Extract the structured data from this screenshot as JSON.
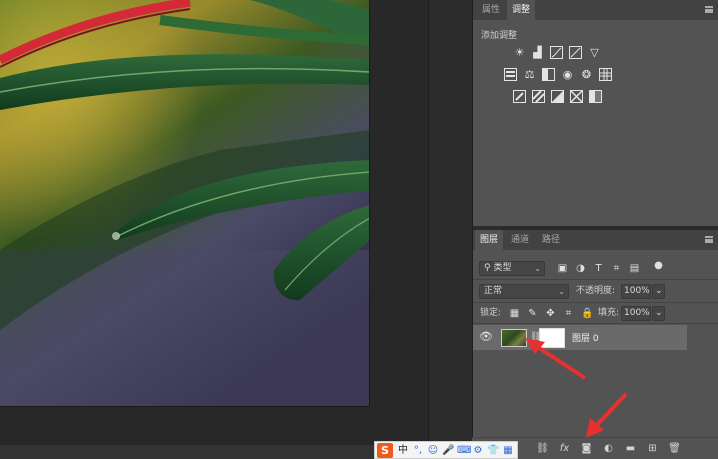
{
  "properties_panel": {
    "tab_properties": "属性",
    "tab_adjustments": "调整",
    "add_adjustment_title": "添加调整",
    "adjustment_icons_row1": [
      "brightness-contrast-icon",
      "levels-icon",
      "curves-icon",
      "exposure-icon",
      "vibrance-icon"
    ],
    "adjustment_icons_row2": [
      "hue-saturation-icon",
      "color-balance-icon",
      "black-white-icon",
      "photo-filter-icon",
      "channel-mixer-icon",
      "color-lookup-icon"
    ],
    "adjustment_icons_row3": [
      "invert-icon",
      "posterize-icon",
      "threshold-icon",
      "selective-color-icon",
      "gradient-map-icon"
    ]
  },
  "layers_panel": {
    "tab_layers": "图层",
    "tab_channels": "通道",
    "tab_paths": "路径",
    "filter_kind": "类型",
    "blend_mode": "正常",
    "opacity_label": "不透明度:",
    "opacity_value": "100%",
    "lock_label": "锁定:",
    "fill_label": "填充:",
    "fill_value": "100%",
    "layers": [
      {
        "name": "图层 0",
        "visible": true,
        "has_mask": true
      }
    ],
    "bottom_icons": [
      "link-layers-icon",
      "fx-icon",
      "add-mask-icon",
      "adjustment-layer-icon",
      "new-group-icon",
      "new-layer-icon",
      "delete-icon"
    ],
    "fx_label": "fx"
  },
  "ime_toolbar": {
    "logo": "S",
    "mode": "中"
  },
  "annotations": {
    "arrow_color": "#e8312f"
  }
}
